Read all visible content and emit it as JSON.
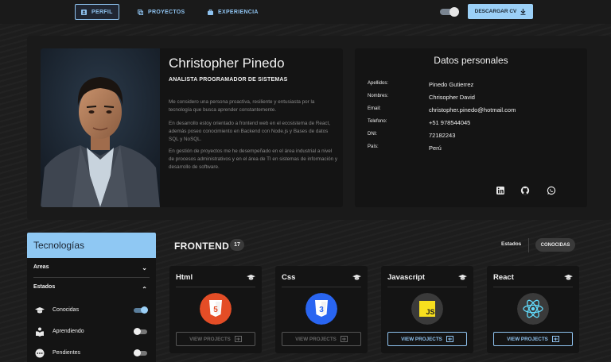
{
  "nav": {
    "items": [
      {
        "label": "PERFIL",
        "icon": "id-card-icon"
      },
      {
        "label": "PROYECTOS",
        "icon": "projects-icon"
      },
      {
        "label": "EXPERIENCIA",
        "icon": "briefcase-icon"
      }
    ],
    "active_index": 0,
    "theme_toggle_on": true,
    "cv_button": "DESCARGAR CV"
  },
  "profile": {
    "name": "Christopher Pinedo",
    "role": "ANALISTA PROGRAMADOR DE SISTEMAS",
    "bio": [
      "Me considero una persona proactiva, resiliente y entusiasta por la tecnología que busca aprender constantemente.",
      "En desarrollo estoy orientado a frontend web en el ecosistema de React, además poseo conocimiento en Backend con Node.js y Bases de datos SQL y NoSQL.",
      "En gestión de proyectos me he desempeñado en el área industrial a nivel de procesos administrativos y en el área de TI en sistemas de información y desarrollo de software."
    ]
  },
  "personal": {
    "title": "Datos personales",
    "rows": [
      {
        "key": "Apellidos:",
        "value": "Pinedo Gutierrez"
      },
      {
        "key": "Nombres:",
        "value": "Chrisopher David"
      },
      {
        "key": "Email:",
        "value": "christopher.pinedo@hotmail.com"
      },
      {
        "key": "Telefono:",
        "value": "+51 978544045"
      },
      {
        "key": "DNI:",
        "value": "72182243"
      },
      {
        "key": "País:",
        "value": "Perú"
      }
    ],
    "social_icons": [
      "linkedin-icon",
      "github-icon",
      "whatsapp-icon"
    ]
  },
  "sidebar": {
    "title": "Tecnologías",
    "areas_label": "Areas",
    "estados_label": "Estados",
    "estados": [
      {
        "label": "Conocidas",
        "icon": "graduation-cap-icon",
        "on": true
      },
      {
        "label": "Aprendiendo",
        "icon": "book-reader-icon",
        "on": false
      },
      {
        "label": "Pendientes",
        "icon": "ellipsis-icon",
        "on": false
      }
    ]
  },
  "frontend": {
    "title": "FRONTEND",
    "count": "17",
    "estados_label": "Estados",
    "filter_chip": "CONOCIDAS",
    "view_label": "VIEW PROJECTS",
    "techs": [
      {
        "name": "Html",
        "logo_text": "5",
        "color": "#e44d26",
        "active": false
      },
      {
        "name": "Css",
        "logo_text": "3",
        "color": "#2965f1",
        "active": false
      },
      {
        "name": "Javascript",
        "logo_text": "JS",
        "color": "#f7df1e",
        "active": true
      },
      {
        "name": "React",
        "logo_text": "",
        "color": "#61dafb",
        "active": true
      }
    ]
  }
}
